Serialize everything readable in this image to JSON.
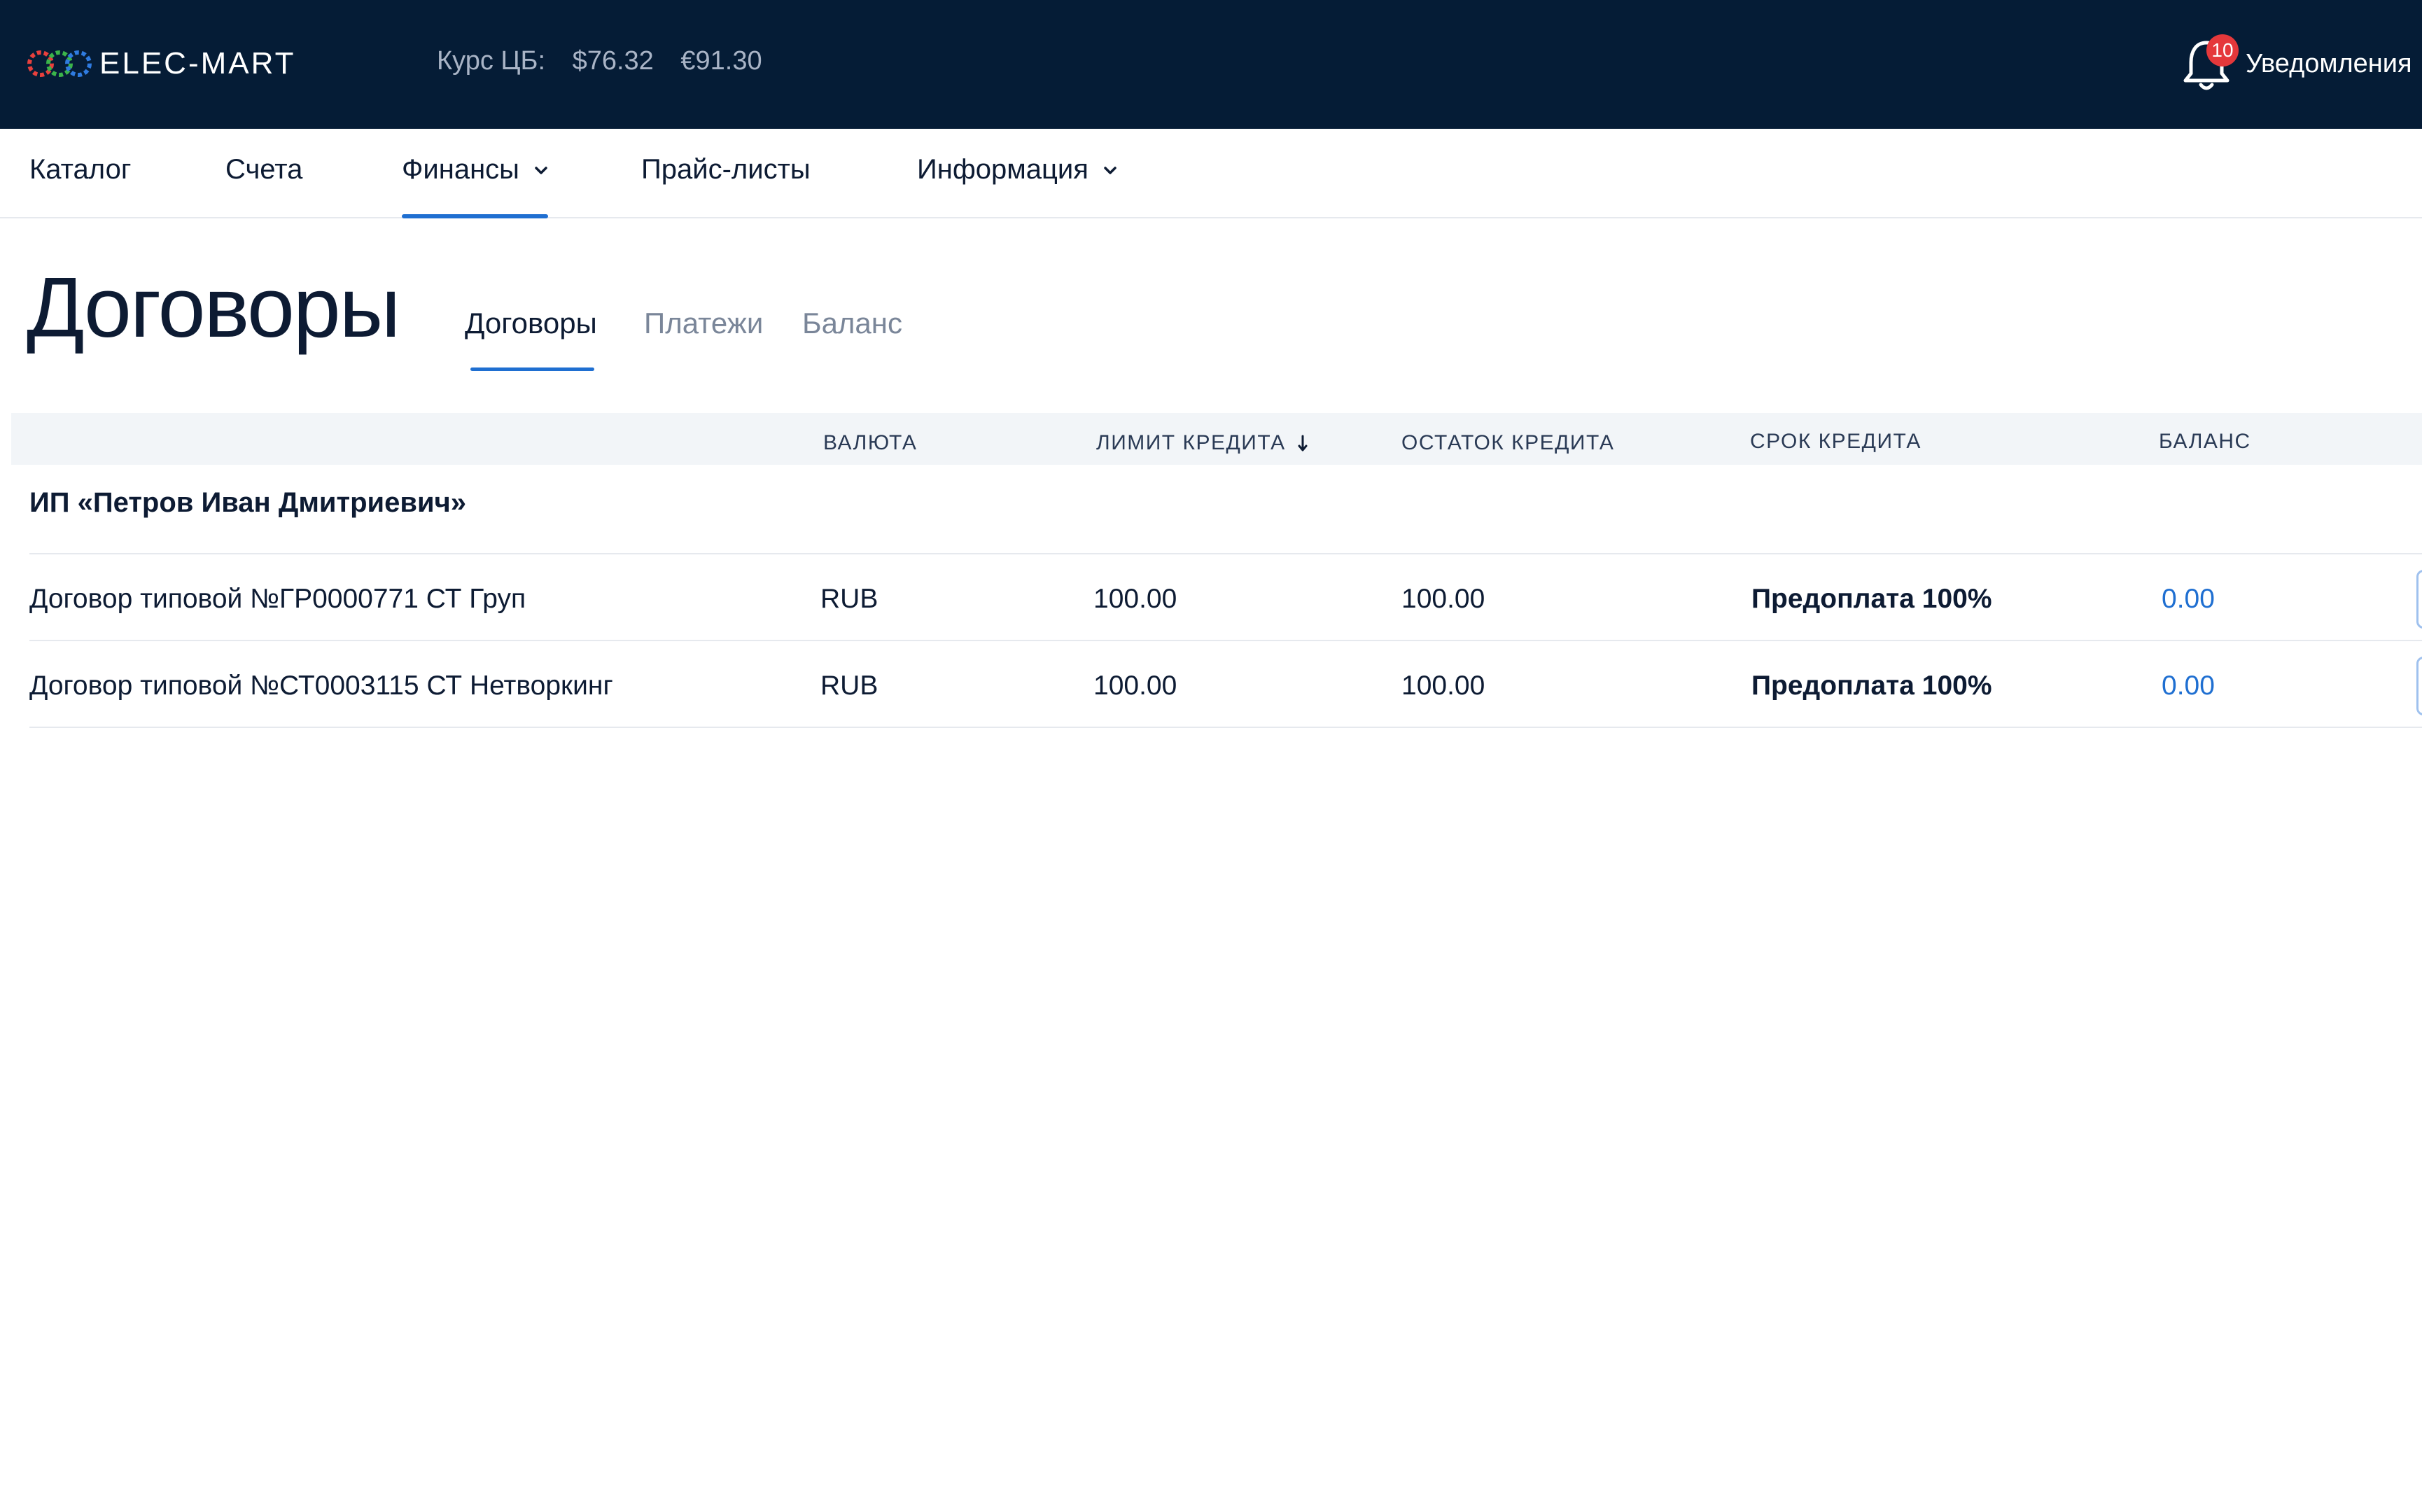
{
  "header": {
    "logo_text": "ELEC-MART",
    "rates_label": "Курс ЦБ:",
    "usd_rate": "$76.32",
    "eur_rate": "€91.30",
    "notifications_count": "10",
    "notifications_label": "Уведомления",
    "colors": {
      "background": "#051c36",
      "badge": "#e5383b"
    }
  },
  "nav": {
    "items": [
      {
        "label": "Каталог"
      },
      {
        "label": "Счета"
      },
      {
        "label": "Финансы",
        "has_dropdown": true,
        "active": true
      },
      {
        "label": "Прайс-листы"
      },
      {
        "label": "Информация",
        "has_dropdown": true
      }
    ],
    "accent_color": "#1f6fd1"
  },
  "page": {
    "title": "Договоры",
    "tabs": [
      {
        "label": "Договоры",
        "active": true
      },
      {
        "label": "Платежи"
      },
      {
        "label": "Баланс"
      }
    ]
  },
  "table": {
    "columns": [
      {
        "label": "ВАЛЮТА"
      },
      {
        "label": "ЛИМИТ КРЕДИТА",
        "sorted": "desc"
      },
      {
        "label": "ОСТАТОК КРЕДИТА"
      },
      {
        "label": "СРОК КРЕДИТА"
      },
      {
        "label": "БАЛАНС"
      }
    ],
    "group": "ИП «Петров Иван Дмитриевич»",
    "rows": [
      {
        "name": "Договор типовой №ГР0000771 СТ Груп",
        "currency": "RUB",
        "credit_limit": "100.00",
        "credit_remaining": "100.00",
        "credit_term": "Предоплата 100%",
        "balance": "0.00"
      },
      {
        "name": "Договор типовой №СТ0003115 СТ Нетворкинг",
        "currency": "RUB",
        "credit_limit": "100.00",
        "credit_remaining": "100.00",
        "credit_term": "Предоплата 100%",
        "balance": "0.00"
      }
    ]
  }
}
